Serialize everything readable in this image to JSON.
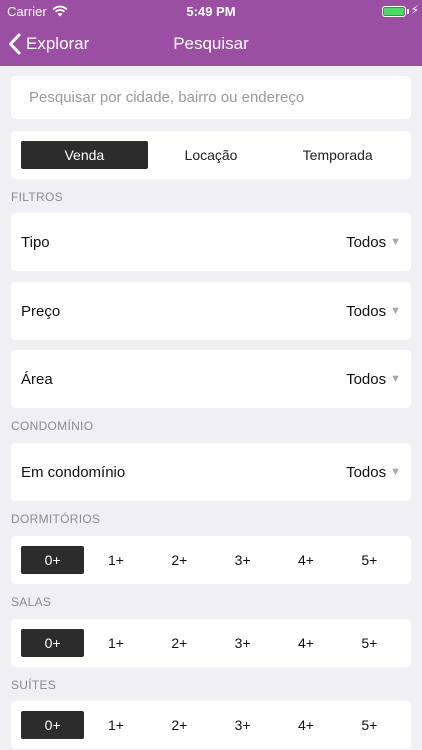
{
  "status_bar": {
    "carrier": "Carrier",
    "time": "5:49 PM",
    "wifi_icon": "wifi-icon",
    "battery_icon": "battery-icon",
    "charging_icon": "bolt-icon"
  },
  "nav": {
    "back_label": "Explorar",
    "back_icon": "chevron-left-icon",
    "title": "Pesquisar"
  },
  "search": {
    "placeholder": "Pesquisar por cidade, bairro ou endereço",
    "value": ""
  },
  "tabs": [
    "Venda",
    "Locação",
    "Temporada"
  ],
  "active_tab": "Venda",
  "colors": {
    "brand": "#9b4fa3",
    "selected": "#2c2c2c",
    "background": "#efeff4"
  },
  "filters": {
    "section_title": "FILTROS",
    "rows": [
      {
        "label": "Tipo",
        "value": "Todos"
      },
      {
        "label": "Preço",
        "value": "Todos"
      },
      {
        "label": "Área",
        "value": "Todos"
      }
    ]
  },
  "condominio": {
    "section_title": "CONDOMÍNIO",
    "row": {
      "label": "Em condomínio",
      "value": "Todos"
    }
  },
  "dormitorios": {
    "section_title": "DORMITÓRIOS",
    "options": [
      "0+",
      "1+",
      "2+",
      "3+",
      "4+",
      "5+"
    ],
    "selected": "0+"
  },
  "salas": {
    "section_title": "SALAS",
    "options": [
      "0+",
      "1+",
      "2+",
      "3+",
      "4+",
      "5+"
    ],
    "selected": "0+"
  },
  "suites": {
    "section_title": "SUÍTES",
    "options": [
      "0+",
      "1+",
      "2+",
      "3+",
      "4+",
      "5+"
    ],
    "selected": "0+"
  }
}
